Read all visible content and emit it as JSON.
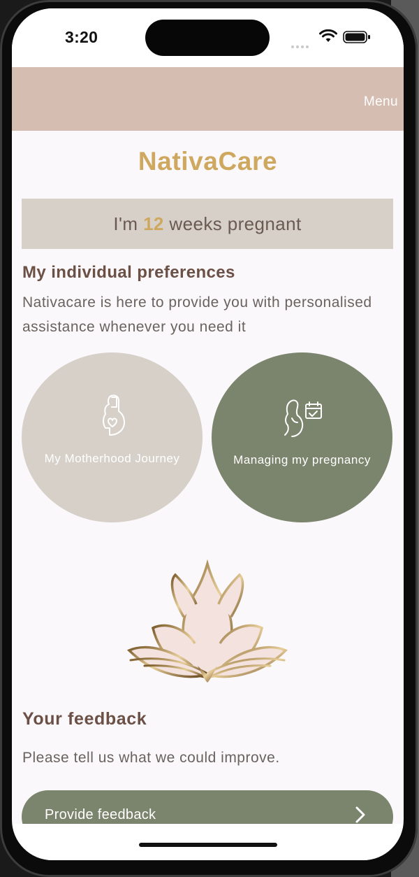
{
  "status": {
    "time": "3:20"
  },
  "header": {
    "menu_label": "Menu"
  },
  "brand": {
    "title": "NativaCare"
  },
  "pregnancy": {
    "prefix": "I'm ",
    "weeks": "12",
    "suffix": " weeks pregnant"
  },
  "preferences": {
    "title": "My individual preferences",
    "description": "Nativacare is here to provide you with personalised assistance whenever you need it",
    "cards": [
      {
        "label": "My Motherhood Journey",
        "icon": "pregnant-heart-icon",
        "color": "#d6d0c9"
      },
      {
        "label": "Managing my pregnancy",
        "icon": "pregnant-calendar-icon",
        "color": "#7b846c"
      }
    ]
  },
  "feedback": {
    "title": "Your feedback",
    "description": "Please tell us what we could improve.",
    "button_label": "Provide feedback"
  },
  "colors": {
    "accent_gold": "#cfa85f",
    "sage": "#7b846c",
    "blush": "#d6bdb1",
    "stone": "#d6d0c9"
  }
}
